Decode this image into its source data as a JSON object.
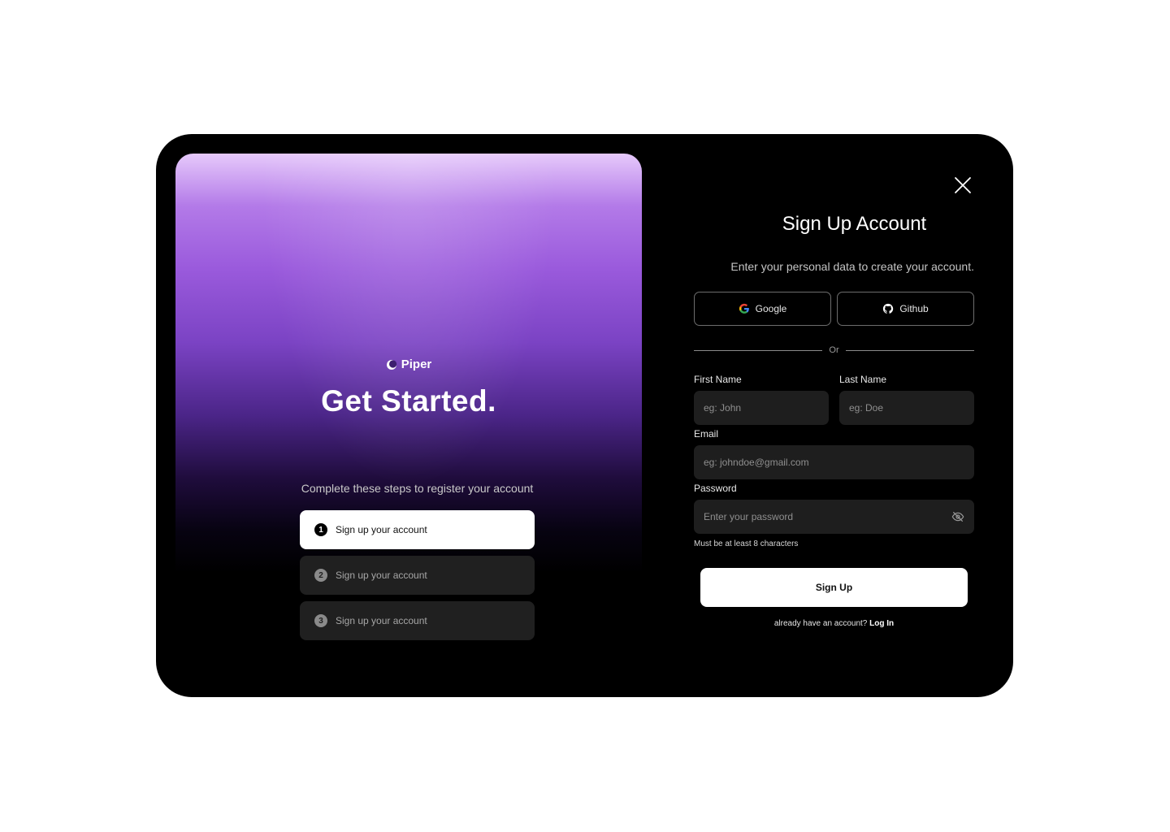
{
  "brand": {
    "name": "Piper"
  },
  "hero": {
    "title": "Get Started.",
    "steps_caption": "Complete these steps to register your account",
    "steps": [
      {
        "number": "1",
        "label": "Sign up your account",
        "state": "active"
      },
      {
        "number": "2",
        "label": "Sign up your account",
        "state": "inactive"
      },
      {
        "number": "3",
        "label": "Sign up your account",
        "state": "inactive"
      }
    ]
  },
  "form": {
    "title": "Sign Up Account",
    "subtitle": "Enter your personal data to create your account.",
    "oauth": {
      "google_label": "Google",
      "github_label": "Github"
    },
    "divider_label": "Or",
    "first_name": {
      "label": "First Name",
      "placeholder": "eg: John",
      "value": ""
    },
    "last_name": {
      "label": "Last Name",
      "placeholder": "eg: Doe",
      "value": ""
    },
    "email": {
      "label": "Email",
      "placeholder": "eg: johndoe@gmail.com",
      "value": ""
    },
    "password": {
      "label": "Password",
      "placeholder": "Enter your password",
      "value": "",
      "hint": "Must be at least 8 characters"
    },
    "submit_label": "Sign Up",
    "login_prompt": "already have an account?",
    "login_link": "Log In"
  },
  "icons": {
    "close": "close-icon",
    "brand": "piper-logo-icon",
    "google": "google-icon",
    "github": "github-icon",
    "password_toggle": "eye-off-icon"
  },
  "colors": {
    "background": "#000000",
    "accent_purple": "#9a5adc",
    "button": "#ffffff",
    "field": "#1e1e1e"
  }
}
